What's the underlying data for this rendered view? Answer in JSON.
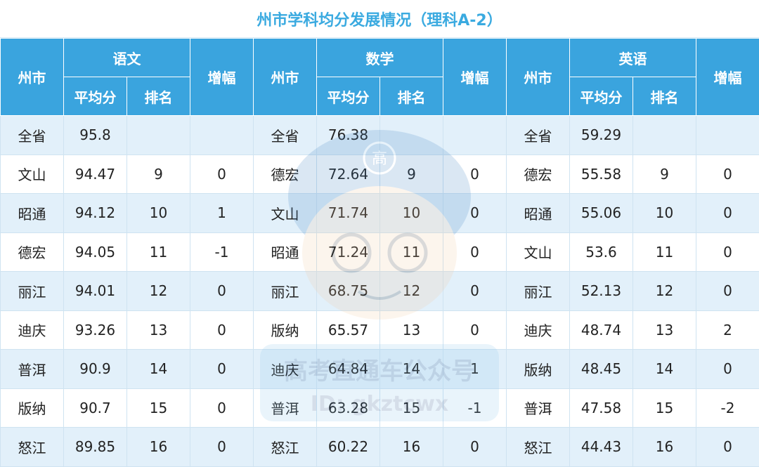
{
  "title": "州市学科均分发展情况（理科A-2）",
  "colors": {
    "header_bg": "#3aa4de",
    "title_text": "#3aaae0",
    "alt_row": "#e2f0fa"
  },
  "header": {
    "city": "州市",
    "subjects": [
      "语文",
      "数学",
      "英语"
    ],
    "avg": "平均分",
    "rank": "排名",
    "change": "增幅"
  },
  "watermark": {
    "char": "高",
    "line1": "高考直通车公众号",
    "line2": "ID: gkztcwx"
  },
  "rows": [
    [
      [
        "全省",
        "95.8",
        "",
        ""
      ],
      [
        "全省",
        "76.38",
        "",
        ""
      ],
      [
        "全省",
        "59.29",
        "",
        ""
      ]
    ],
    [
      [
        "文山",
        "94.47",
        "9",
        "0"
      ],
      [
        "德宏",
        "72.64",
        "9",
        "0"
      ],
      [
        "德宏",
        "55.58",
        "9",
        "0"
      ]
    ],
    [
      [
        "昭通",
        "94.12",
        "10",
        "1"
      ],
      [
        "文山",
        "71.74",
        "10",
        "0"
      ],
      [
        "昭通",
        "55.06",
        "10",
        "0"
      ]
    ],
    [
      [
        "德宏",
        "94.05",
        "11",
        "-1"
      ],
      [
        "昭通",
        "71.24",
        "11",
        "0"
      ],
      [
        "文山",
        "53.6",
        "11",
        "0"
      ]
    ],
    [
      [
        "丽江",
        "94.01",
        "12",
        "0"
      ],
      [
        "丽江",
        "68.75",
        "12",
        "0"
      ],
      [
        "丽江",
        "52.13",
        "12",
        "0"
      ]
    ],
    [
      [
        "迪庆",
        "93.26",
        "13",
        "0"
      ],
      [
        "版纳",
        "65.57",
        "13",
        "0"
      ],
      [
        "迪庆",
        "48.74",
        "13",
        "2"
      ]
    ],
    [
      [
        "普洱",
        "90.9",
        "14",
        "0"
      ],
      [
        "迪庆",
        "64.84",
        "14",
        "1"
      ],
      [
        "版纳",
        "48.45",
        "14",
        "0"
      ]
    ],
    [
      [
        "版纳",
        "90.7",
        "15",
        "0"
      ],
      [
        "普洱",
        "63.28",
        "15",
        "-1"
      ],
      [
        "普洱",
        "47.58",
        "15",
        "-2"
      ]
    ],
    [
      [
        "怒江",
        "89.85",
        "16",
        "0"
      ],
      [
        "怒江",
        "60.22",
        "16",
        "0"
      ],
      [
        "怒江",
        "44.43",
        "16",
        "0"
      ]
    ]
  ]
}
